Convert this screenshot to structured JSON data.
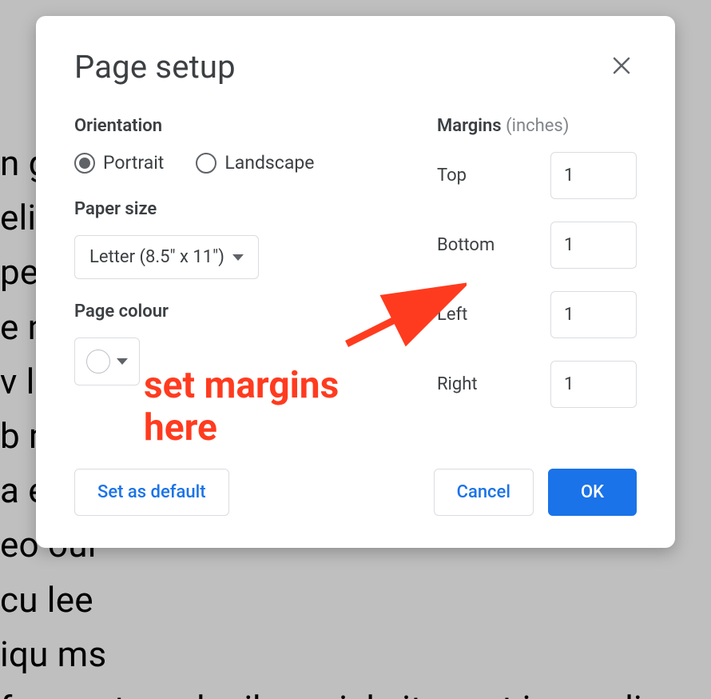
{
  "dialog": {
    "title": "Page setup",
    "orientation": {
      "label": "Orientation",
      "portrait": "Portrait",
      "landscape": "Landscape",
      "selected": "portrait"
    },
    "paper_size": {
      "label": "Paper size",
      "value": "Letter (8.5\" x 11\")"
    },
    "page_color": {
      "label": "Page colour",
      "value": "#ffffff"
    },
    "margins": {
      "label": "Margins",
      "units": "(inches)",
      "top": {
        "label": "Top",
        "value": "1"
      },
      "bottom": {
        "label": "Bottom",
        "value": "1"
      },
      "left": {
        "label": "Left",
        "value": "1"
      },
      "right": {
        "label": "Right",
        "value": "1"
      }
    },
    "buttons": {
      "set_default": "Set as default",
      "cancel": "Cancel",
      "ok": "OK"
    }
  },
  "annotation": {
    "line1": "set margins",
    "line2": "here"
  },
  "bg_text": "n                                                                                g\neli                                                                               n a\npe                                                                                dic\n e                                                                                 n a\n  v                                                                               lig\n  b                                                                               ms\n a                                                                                eu\neo                                                                                oul\ncu                                                                                lee\niqu                                                                               ms\n      formentum  danibus nicl  sit amot imnordi"
}
